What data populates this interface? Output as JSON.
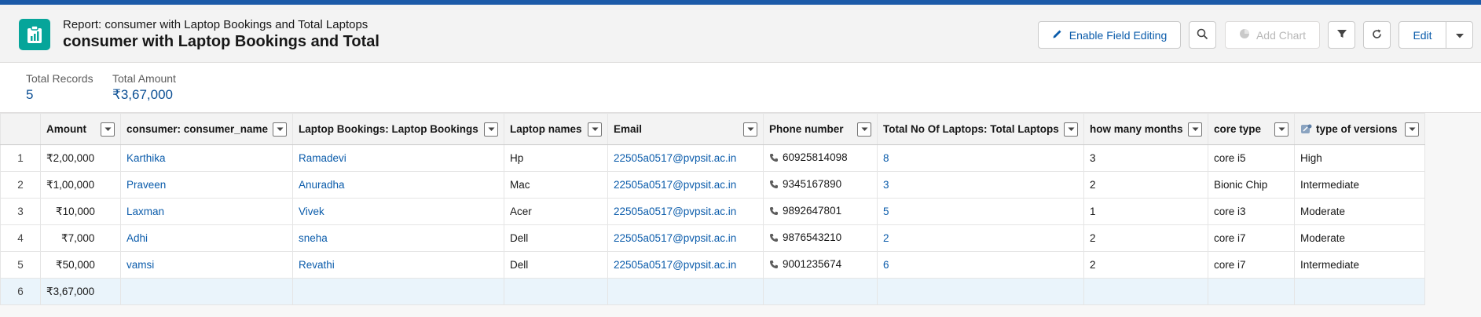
{
  "header": {
    "eyebrow": "Report: consumer with Laptop Bookings and Total Laptops",
    "title": "consumer with Laptop Bookings and Total",
    "enable_field_editing": "Enable Field Editing",
    "add_chart": "Add Chart",
    "edit": "Edit"
  },
  "summary": {
    "total_records_label": "Total Records",
    "total_records_value": "5",
    "total_amount_label": "Total Amount",
    "total_amount_value": "₹3,67,000"
  },
  "table": {
    "columns": [
      "Amount",
      "consumer: consumer_name",
      "Laptop Bookings: Laptop Bookings",
      "Laptop names",
      "Email",
      "Phone number",
      "Total No Of Laptops: Total Laptops",
      "how many months",
      "core type",
      "type of versions"
    ],
    "rows": [
      {
        "num": "1",
        "amount": "₹2,00,000",
        "consumer": "Karthika",
        "booking": "Ramadevi",
        "laptop": "Hp",
        "email": "22505a0517@pvpsit.ac.in",
        "phone": "60925814098",
        "total": "8",
        "months": "3",
        "core": "core i5",
        "version": "High"
      },
      {
        "num": "2",
        "amount": "₹1,00,000",
        "consumer": "Praveen",
        "booking": "Anuradha",
        "laptop": "Mac",
        "email": "22505a0517@pvpsit.ac.in",
        "phone": "9345167890",
        "total": "3",
        "months": "2",
        "core": "Bionic Chip",
        "version": "Intermediate"
      },
      {
        "num": "3",
        "amount": "₹10,000",
        "consumer": "Laxman",
        "booking": "Vivek",
        "laptop": "Acer",
        "email": "22505a0517@pvpsit.ac.in",
        "phone": "9892647801",
        "total": "5",
        "months": "1",
        "core": "core i3",
        "version": "Moderate"
      },
      {
        "num": "4",
        "amount": "₹7,000",
        "consumer": "Adhi",
        "booking": "sneha",
        "laptop": "Dell",
        "email": "22505a0517@pvpsit.ac.in",
        "phone": "9876543210",
        "total": "2",
        "months": "2",
        "core": "core i7",
        "version": "Moderate"
      },
      {
        "num": "5",
        "amount": "₹50,000",
        "consumer": "vamsi",
        "booking": "Revathi",
        "laptop": "Dell",
        "email": "22505a0517@pvpsit.ac.in",
        "phone": "9001235674",
        "total": "6",
        "months": "2",
        "core": "core i7",
        "version": "Intermediate"
      }
    ],
    "total_row": {
      "num": "6",
      "amount": "₹3,67,000"
    }
  },
  "colors": {
    "brand_blue": "#1b5aa8",
    "report_icon": "#06a59a",
    "link": "#0b5cab"
  },
  "icons": [
    "report-icon",
    "pencil-icon",
    "search-icon",
    "chart-icon",
    "filter-icon",
    "refresh-icon",
    "chevron-down-icon",
    "phone-icon",
    "formula-icon"
  ]
}
